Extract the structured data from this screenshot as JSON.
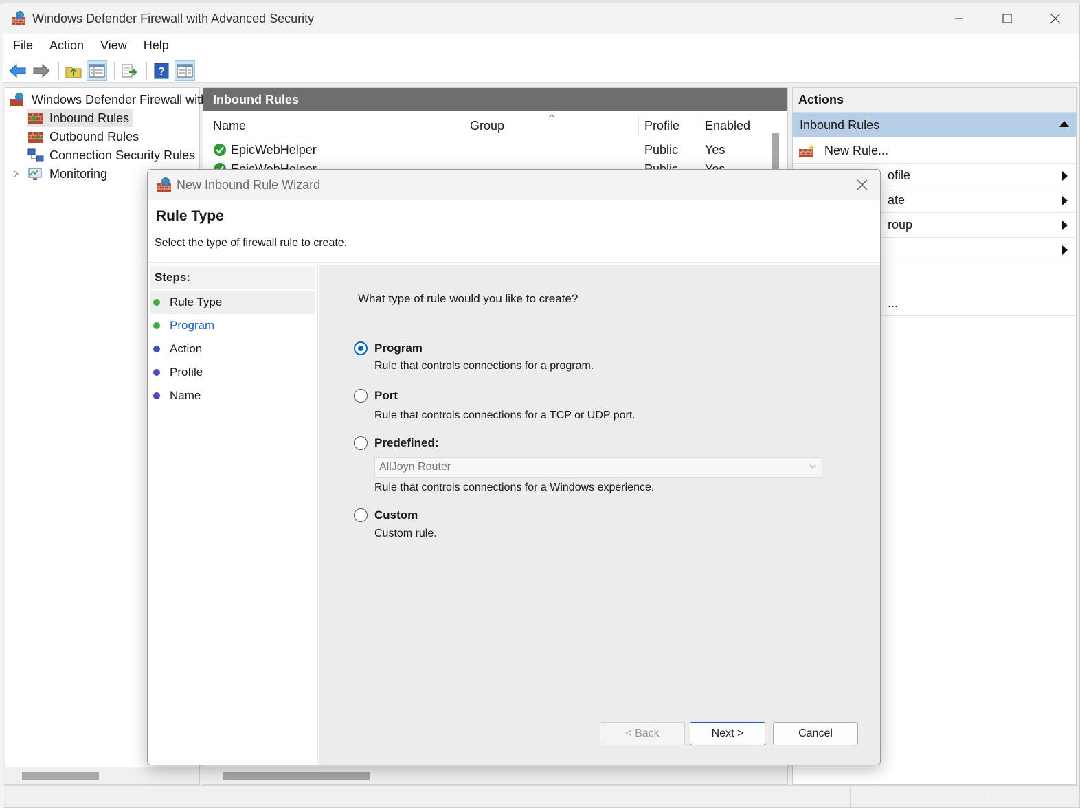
{
  "window": {
    "title": "Windows Defender Firewall with Advanced Security",
    "controls": {
      "minimize": "—",
      "maximize": "☐",
      "close": "✕"
    }
  },
  "menu": [
    "File",
    "Action",
    "View",
    "Help"
  ],
  "tree": {
    "root": "Windows Defender Firewall with",
    "items": [
      "Inbound Rules",
      "Outbound Rules",
      "Connection Security Rules",
      "Monitoring"
    ],
    "selected": "Inbound Rules"
  },
  "center": {
    "header": "Inbound Rules",
    "columns": [
      "Name",
      "Group",
      "Profile",
      "Enabled"
    ],
    "rows": [
      {
        "name": "EpicWebHelper",
        "group": "",
        "profile": "Public",
        "enabled": "Yes"
      },
      {
        "name": "EpicWebHelper",
        "group": "",
        "profile": "Public",
        "enabled": "Yes"
      }
    ]
  },
  "actions": {
    "header": "Actions",
    "section": "Inbound Rules",
    "items": [
      {
        "label": "New Rule..."
      },
      {
        "label": "ofile"
      },
      {
        "label": "ate"
      },
      {
        "label": "roup"
      },
      {
        "label": ""
      },
      {
        "label": "..."
      }
    ]
  },
  "wizard": {
    "title": "New Inbound Rule Wizard",
    "heading": "Rule Type",
    "subheading": "Select the type of firewall rule to create.",
    "steps_label": "Steps:",
    "steps": [
      "Rule Type",
      "Program",
      "Action",
      "Profile",
      "Name"
    ],
    "step_colors": [
      "#3fae3f",
      "#3fae3f",
      "#4b4bbf",
      "#4b4bbf",
      "#4b4bbf"
    ],
    "question": "What type of rule would you like to create?",
    "options": [
      {
        "label": "Program",
        "desc": "Rule that controls connections for a program.",
        "checked": true
      },
      {
        "label": "Port",
        "desc": "Rule that controls connections for a TCP or UDP port.",
        "checked": false
      },
      {
        "label": "Predefined:",
        "desc": "Rule that controls connections for a Windows experience.",
        "checked": false,
        "select_value": "AllJoyn Router"
      },
      {
        "label": "Custom",
        "desc": "Custom rule.",
        "checked": false
      }
    ],
    "buttons": {
      "back": "< Back",
      "next": "Next >",
      "cancel": "Cancel"
    }
  },
  "colors": {
    "accent": "#0067c0",
    "selection": "#b7cfe6",
    "pane_header": "#6e6e6e"
  }
}
